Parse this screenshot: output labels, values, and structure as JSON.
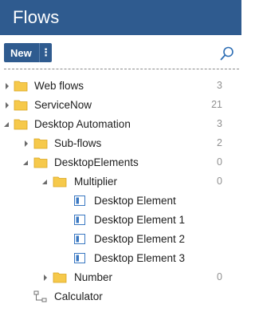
{
  "header": {
    "title": "Flows"
  },
  "toolbar": {
    "new_label": "New",
    "more_label": "⋮",
    "search_icon": "search-icon"
  },
  "tree": {
    "items": [
      {
        "label": "Web flows",
        "count": "3",
        "type": "folder",
        "expanded": false
      },
      {
        "label": "ServiceNow",
        "count": "21",
        "type": "folder",
        "expanded": false
      },
      {
        "label": "Desktop Automation",
        "count": "3",
        "type": "folder",
        "expanded": true
      },
      {
        "label": "Sub-flows",
        "count": "2",
        "type": "folder",
        "expanded": false
      },
      {
        "label": "DesktopElements",
        "count": "0",
        "type": "folder",
        "expanded": true
      },
      {
        "label": "Multiplier",
        "count": "0",
        "type": "folder",
        "expanded": true
      },
      {
        "label": "Desktop Element",
        "count": "",
        "type": "element"
      },
      {
        "label": "Desktop Element 1",
        "count": "",
        "type": "element"
      },
      {
        "label": "Desktop Element 2",
        "count": "",
        "type": "element"
      },
      {
        "label": "Desktop Element 3",
        "count": "",
        "type": "element"
      },
      {
        "label": "Number",
        "count": "0",
        "type": "folder",
        "expanded": false
      },
      {
        "label": "Calculator",
        "count": "",
        "type": "flow"
      }
    ]
  },
  "colors": {
    "header_bg": "#2f5b8f",
    "folder": "#f6c94b",
    "element_icon": "#3a78c2"
  }
}
